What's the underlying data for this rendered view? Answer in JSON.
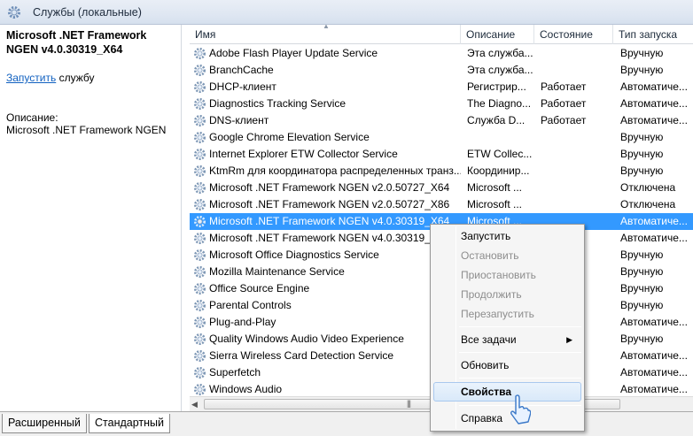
{
  "window": {
    "title": "Службы (локальные)"
  },
  "details": {
    "service_name": "Microsoft .NET Framework NGEN v4.0.30319_X64",
    "start_link": "Запустить",
    "start_suffix": " службу",
    "description_label": "Описание:",
    "description_text": "Microsoft .NET Framework NGEN"
  },
  "columns": {
    "name": "Имя",
    "description": "Описание",
    "state": "Состояние",
    "startup": "Тип запуска"
  },
  "services": [
    {
      "name": "Adobe Flash Player Update Service",
      "description": "Эта служба...",
      "state": "",
      "startup": "Вручную"
    },
    {
      "name": "BranchCache",
      "description": "Эта служба...",
      "state": "",
      "startup": "Вручную"
    },
    {
      "name": "DHCP-клиент",
      "description": "Регистрир...",
      "state": "Работает",
      "startup": "Автоматиче..."
    },
    {
      "name": "Diagnostics Tracking Service",
      "description": "The Diagno...",
      "state": "Работает",
      "startup": "Автоматиче..."
    },
    {
      "name": "DNS-клиент",
      "description": "Служба D...",
      "state": "Работает",
      "startup": "Автоматиче..."
    },
    {
      "name": "Google Chrome Elevation Service",
      "description": "",
      "state": "",
      "startup": "Вручную"
    },
    {
      "name": "Internet Explorer ETW Collector Service",
      "description": "ETW Collec...",
      "state": "",
      "startup": "Вручную"
    },
    {
      "name": "KtmRm для координатора распределенных транз...",
      "description": "Координир...",
      "state": "",
      "startup": "Вручную"
    },
    {
      "name": "Microsoft .NET Framework NGEN v2.0.50727_X64",
      "description": "Microsoft ...",
      "state": "",
      "startup": "Отключена"
    },
    {
      "name": "Microsoft .NET Framework NGEN v2.0.50727_X86",
      "description": "Microsoft ...",
      "state": "",
      "startup": "Отключена"
    },
    {
      "name": "Microsoft .NET Framework NGEN v4.0.30319_X64",
      "description": "Microsoft ...",
      "state": "",
      "startup": "Автоматиче..."
    },
    {
      "name": "Microsoft .NET Framework NGEN v4.0.30319_X86",
      "description": "",
      "state": "",
      "startup": "Автоматиче..."
    },
    {
      "name": "Microsoft Office Diagnostics Service",
      "description": "",
      "state": "",
      "startup": "Вручную"
    },
    {
      "name": "Mozilla Maintenance Service",
      "description": "",
      "state": "",
      "startup": "Вручную"
    },
    {
      "name": "Office Source Engine",
      "description": "",
      "state": "",
      "startup": "Вручную"
    },
    {
      "name": "Parental Controls",
      "description": "",
      "state": "",
      "startup": "Вручную"
    },
    {
      "name": "Plug-and-Play",
      "description": "",
      "state": "",
      "startup": "Автоматиче..."
    },
    {
      "name": "Quality Windows Audio Video Experience",
      "description": "",
      "state": "",
      "startup": "Вручную"
    },
    {
      "name": "Sierra Wireless Card Detection Service",
      "description": "",
      "state": "",
      "startup": "Автоматиче..."
    },
    {
      "name": "Superfetch",
      "description": "",
      "state": "",
      "startup": "Автоматиче..."
    },
    {
      "name": "Windows Audio",
      "description": "",
      "state": "",
      "startup": "Автоматиче..."
    }
  ],
  "selected_index": 10,
  "context_menu": {
    "start": "Запустить",
    "stop": "Остановить",
    "pause": "Приостановить",
    "resume": "Продолжить",
    "restart": "Перезапустить",
    "all_tasks": "Все задачи",
    "refresh": "Обновить",
    "properties": "Свойства",
    "help": "Справка"
  },
  "tabs": {
    "extended": "Расширенный",
    "standard": "Стандартный"
  },
  "colors": {
    "selection": "#3399ff",
    "link": "#1060c0"
  }
}
